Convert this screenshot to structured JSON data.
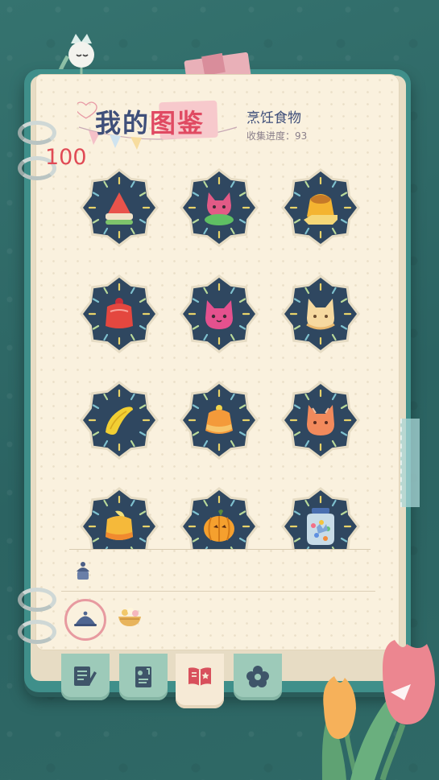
{
  "header": {
    "title_part1": "我的",
    "title_part2": "图鉴",
    "category": "烹饪食物",
    "progress_label": "收集进度：",
    "progress_value": "93"
  },
  "score": "100",
  "items": [
    {
      "name": "watermelon-jelly",
      "icon": "red-cone-jelly",
      "color": "#e8534b"
    },
    {
      "name": "green-cat-jelly",
      "icon": "pink-cat-green-base",
      "color": "#e25a86"
    },
    {
      "name": "pudding-caramel",
      "icon": "yellow-pudding",
      "color": "#f4b431"
    },
    {
      "name": "strawberry-jelly",
      "icon": "red-jelly-cup",
      "color": "#e4473f"
    },
    {
      "name": "pink-cat-jelly",
      "icon": "pink-cat-jelly",
      "color": "#e4518e"
    },
    {
      "name": "cream-cat-jelly",
      "icon": "cream-cat-jelly",
      "color": "#f6d9a0"
    },
    {
      "name": "banana-slice",
      "icon": "banana",
      "color": "#f2cf33"
    },
    {
      "name": "orange-jelly",
      "icon": "orange-jelly",
      "color": "#f49a3a"
    },
    {
      "name": "orange-cat-jelly",
      "icon": "orange-cat-jelly",
      "color": "#f28a5c"
    },
    {
      "name": "banana-pudding",
      "icon": "yellow-jelly-banana",
      "color": "#f5b93a"
    },
    {
      "name": "pumpkin-cake",
      "icon": "pumpkin",
      "color": "#f5a02e"
    },
    {
      "name": "candy-jar",
      "icon": "candy-jar",
      "color": "#7fa6d8"
    }
  ],
  "tools": [
    {
      "name": "cloche",
      "icon": "cloche-icon",
      "active": true
    },
    {
      "name": "food-bowl",
      "icon": "bowl-icon",
      "active": false
    }
  ],
  "tabs": [
    {
      "name": "tab-notes",
      "icon": "note-pencil-icon",
      "active": false
    },
    {
      "name": "tab-cards",
      "icon": "photo-card-icon",
      "active": false
    },
    {
      "name": "tab-collection",
      "icon": "open-book-icon",
      "active": true
    },
    {
      "name": "tab-flowers",
      "icon": "flower-icon",
      "active": false
    }
  ],
  "colors": {
    "badge": "#2f4760",
    "page": "#faf1de",
    "title": "#3f4f7a",
    "score": "#e04a55",
    "tab": "#9dcab9"
  }
}
